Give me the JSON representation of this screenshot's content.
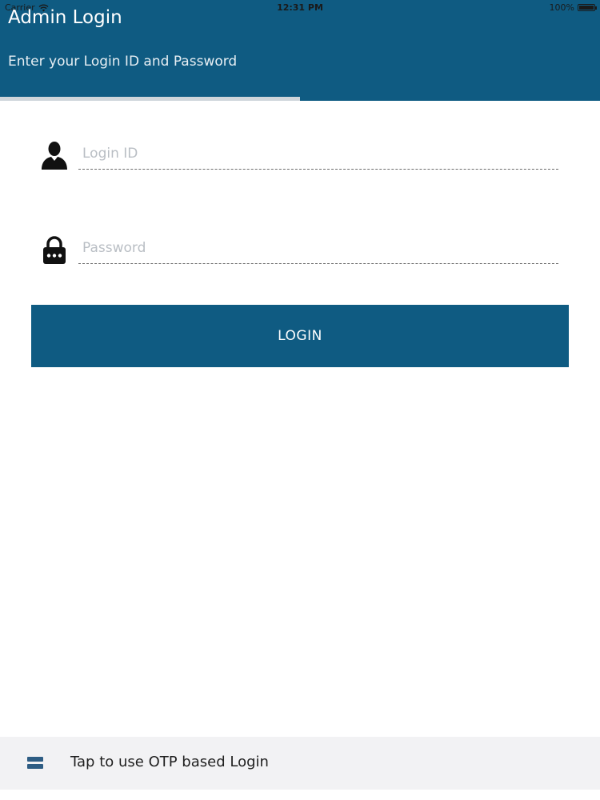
{
  "status_bar": {
    "carrier": "Carrier",
    "time": "12:31 PM",
    "battery": "100%"
  },
  "header": {
    "title": "Admin Login",
    "subtitle": "Enter your Login ID and Password",
    "progress_fraction": 0.5
  },
  "form": {
    "login_id": {
      "placeholder": "Login ID",
      "value": "",
      "icon": "user-icon"
    },
    "password": {
      "placeholder": "Password",
      "value": "",
      "icon": "lock-icon"
    },
    "login_button_label": "LOGIN"
  },
  "footer": {
    "otp_label": "Tap to use OTP based Login",
    "icon": "menu-icon"
  },
  "colors": {
    "primary": "#0f5b82",
    "footer_bg": "#f2f2f4",
    "placeholder": "#b9bec4"
  }
}
